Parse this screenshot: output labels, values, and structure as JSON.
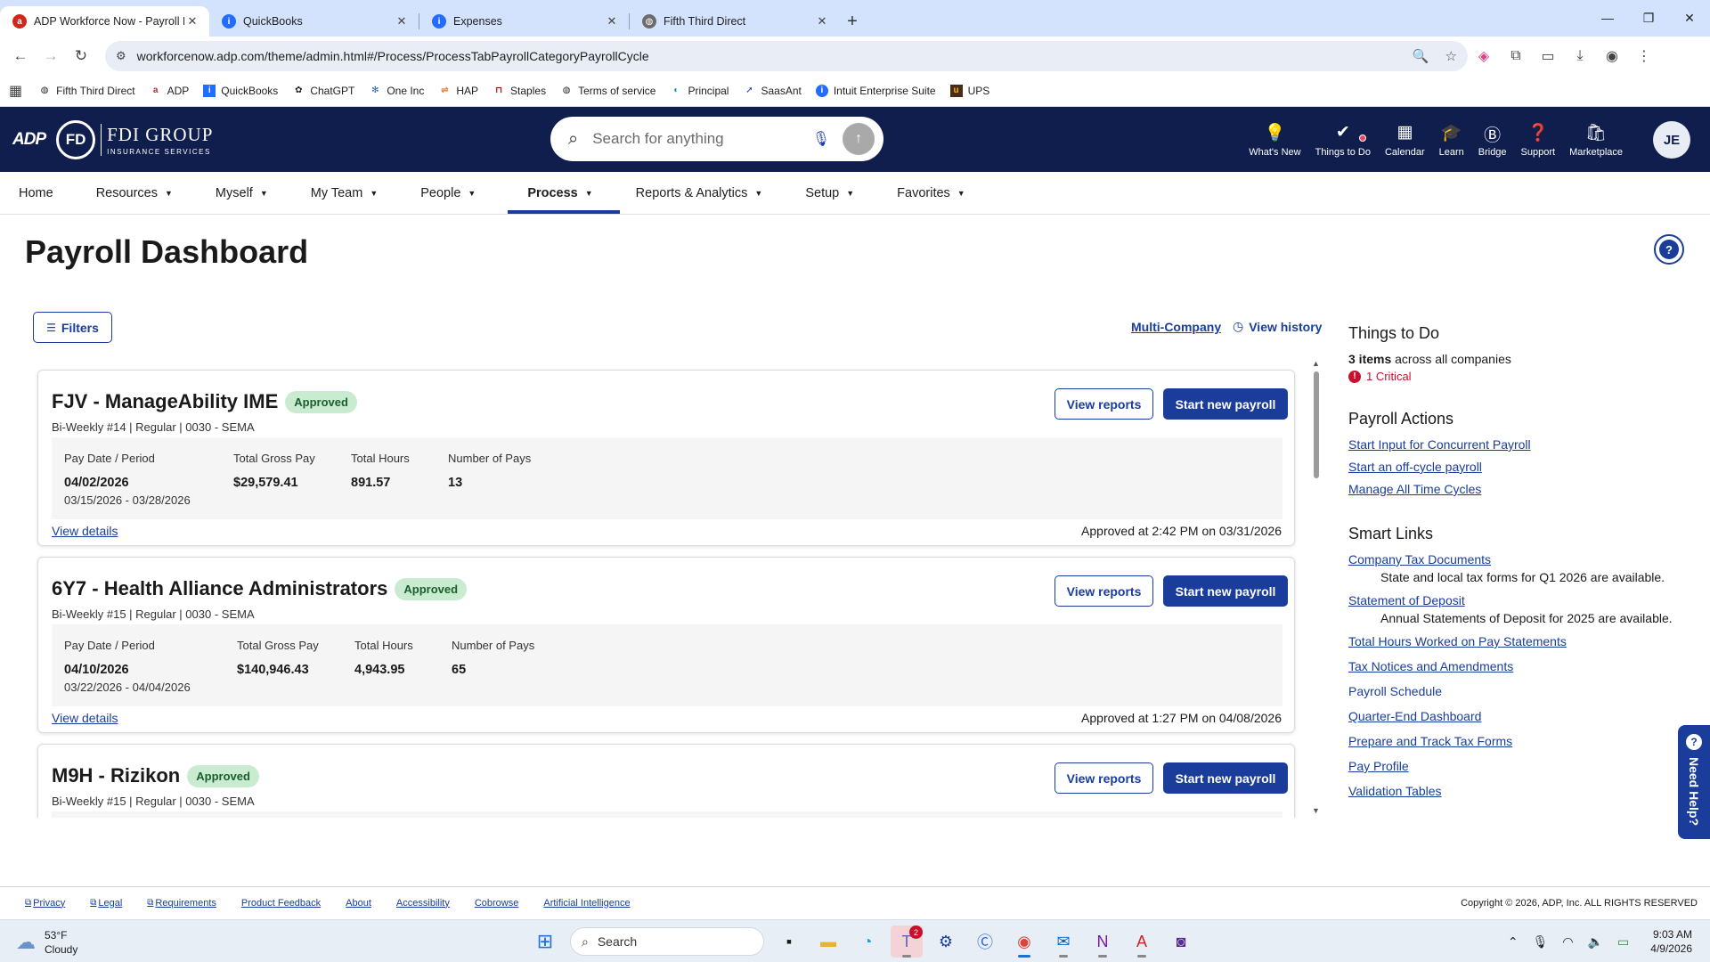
{
  "browser": {
    "tabs": [
      {
        "title": "ADP Workforce Now - Payroll D",
        "icon": "adp-favicon",
        "active": true
      },
      {
        "title": "QuickBooks",
        "icon": "intuit-favicon",
        "active": false
      },
      {
        "title": "Expenses",
        "icon": "intuit-favicon",
        "active": false
      },
      {
        "title": "Fifth Third Direct",
        "icon": "globe-favicon",
        "active": false
      }
    ],
    "url": "workforcenow.adp.com/theme/admin.html#/Process/ProcessTabPayrollCategoryPayrollCycle",
    "bookmarks": [
      "Fifth Third Direct",
      "ADP",
      "QuickBooks",
      "ChatGPT",
      "One Inc",
      "HAP",
      "Staples",
      "Terms of service",
      "Principal",
      "SaasAnt",
      "Intuit Enterprise Suite",
      "UPS"
    ]
  },
  "header": {
    "brand": "FDI GROUP",
    "brand_sub": "INSURANCE SERVICES",
    "adp_mark": "ADP",
    "search_placeholder": "Search for anything",
    "actions": [
      "What's New",
      "Things to Do",
      "Calendar",
      "Learn",
      "Bridge",
      "Support",
      "Marketplace"
    ],
    "avatar_initials": "JE"
  },
  "nav": {
    "items": [
      {
        "label": "Home",
        "dropdown": false
      },
      {
        "label": "Resources",
        "dropdown": true
      },
      {
        "label": "Myself",
        "dropdown": true
      },
      {
        "label": "My Team",
        "dropdown": true
      },
      {
        "label": "People",
        "dropdown": true
      },
      {
        "label": "Process",
        "dropdown": true,
        "active": true
      },
      {
        "label": "Reports & Analytics",
        "dropdown": true
      },
      {
        "label": "Setup",
        "dropdown": true
      },
      {
        "label": "Favorites",
        "dropdown": true
      }
    ]
  },
  "page": {
    "title": "Payroll Dashboard",
    "filters_label": "Filters",
    "multi_company": "Multi-Company",
    "view_history": "View history"
  },
  "payroll_cards": [
    {
      "company": "FJV - ManageAbility IME",
      "status": "Approved",
      "subtitle": "Bi-Weekly #14 | Regular | 0030 - SEMA",
      "pay_date": "04/02/2026",
      "period": "03/15/2026 - 03/28/2026",
      "gross_pay": "$29,579.41",
      "hours": "891.57",
      "pays": "13",
      "approved_text": "Approved at 2:42 PM on 03/31/2026"
    },
    {
      "company": "6Y7 - Health Alliance Administrators",
      "status": "Approved",
      "subtitle": "Bi-Weekly #15 | Regular | 0030 - SEMA",
      "pay_date": "04/10/2026",
      "period": "03/22/2026 - 04/04/2026",
      "gross_pay": "$140,946.43",
      "hours": "4,943.95",
      "pays": "65",
      "approved_text": "Approved at 1:27 PM on 04/08/2026"
    },
    {
      "company": "M9H - Rizikon",
      "status": "Approved",
      "subtitle": "Bi-Weekly #15 | Regular | 0030 - SEMA",
      "pay_date": "",
      "period": "",
      "gross_pay": "",
      "hours": "",
      "pays": "",
      "approved_text": ""
    }
  ],
  "card_labels": {
    "pay_date": "Pay Date / Period",
    "gross": "Total Gross Pay",
    "hours": "Total Hours",
    "pays": "Number of Pays",
    "view_reports": "View reports",
    "start_payroll": "Start new payroll",
    "view_details": "View details"
  },
  "sidebar": {
    "things_to_do": {
      "title": "Things to Do",
      "count": "3 items",
      "count_suffix": "across all companies",
      "critical": "1 Critical"
    },
    "payroll_actions": {
      "title": "Payroll Actions",
      "links": [
        "Start Input for Concurrent Payroll",
        "Start an off-cycle payroll",
        "Manage All Time Cycles"
      ]
    },
    "smart_links": {
      "title": "Smart Links",
      "company_tax": "Company Tax Documents",
      "company_tax_desc": "State and local tax forms for Q1 2026 are available.",
      "statement": "Statement of Deposit",
      "statement_desc": "Annual Statements of Deposit for 2025 are available.",
      "links": [
        "Total Hours Worked on Pay Statements",
        "Tax Notices and Amendments"
      ],
      "payroll_schedule": "Payroll Schedule",
      "links2": [
        "Quarter-End Dashboard",
        "Prepare and Track Tax Forms",
        "Pay Profile",
        "Validation Tables"
      ]
    }
  },
  "need_help": "Need Help?",
  "footer": {
    "links": [
      "Privacy",
      "Legal",
      "Requirements",
      "Product Feedback",
      "About",
      "Accessibility",
      "Cobrowse",
      "Artificial Intelligence"
    ],
    "copyright": "Copyright © 2026, ADP, Inc. ALL RIGHTS RESERVED"
  },
  "taskbar": {
    "temp": "53°F",
    "condition": "Cloudy",
    "search": "Search",
    "teams_badge": "2",
    "time": "9:03 AM",
    "date": "4/9/2026"
  },
  "colors": {
    "brand_navy": "#101e4d",
    "accent_blue": "#1a3d9c",
    "approved_bg": "#c9ecd1",
    "critical_red": "#c8102e"
  }
}
